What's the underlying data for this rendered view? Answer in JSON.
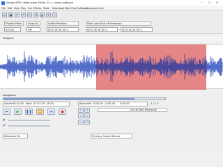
{
  "window": {
    "title": "Simple MP3 Cutter Joiner Editor V2.x - demo software"
  },
  "menu": [
    "File",
    "Edit",
    "View",
    "Play",
    "Cut",
    "Effects",
    "Tools",
    "Download More Free Software",
    "Language",
    "Help"
  ],
  "selection": {
    "rate_label": "Project Rate (Hz)",
    "rate_value": "44100",
    "snap_label": "Snap-To",
    "snap_value": "Off",
    "audio_pos_label": "Audio Position",
    "audio_pos_value": "00 h 00 m 00 s",
    "range_label": "Start and End of Selection",
    "start_value": "00 h 00 m 00 s",
    "end_value": "00 h 00 m 00 s"
  },
  "status": {
    "text": "Stopped."
  },
  "navigation": {
    "heading": "Navigation",
    "total_label": "Gesamt:",
    "total_value": "2:24.43",
    "current_label": "Jetzt:",
    "current_value": "01:57.29",
    "pct": "(81%)",
    "section_label": "Abschnitt:",
    "section_range": "0:00.00 - 0:00.00",
    "section_extra": "0:00.00",
    "counter": "2 / 1 7",
    "monitor": "Click to Start Monitoring",
    "device_in": "Windows Dir",
    "device_out": "Primary Sound Driver"
  },
  "icons": {
    "skip_start": "skip-to-start-icon",
    "play": "play-icon",
    "pause": "pause-icon",
    "skip_end": "skip-to-end-icon",
    "stop": "stop-icon",
    "record": "record-icon"
  },
  "colors": {
    "selection": "#e07070",
    "wave": "#2f4fbf",
    "record": "#e03030"
  }
}
